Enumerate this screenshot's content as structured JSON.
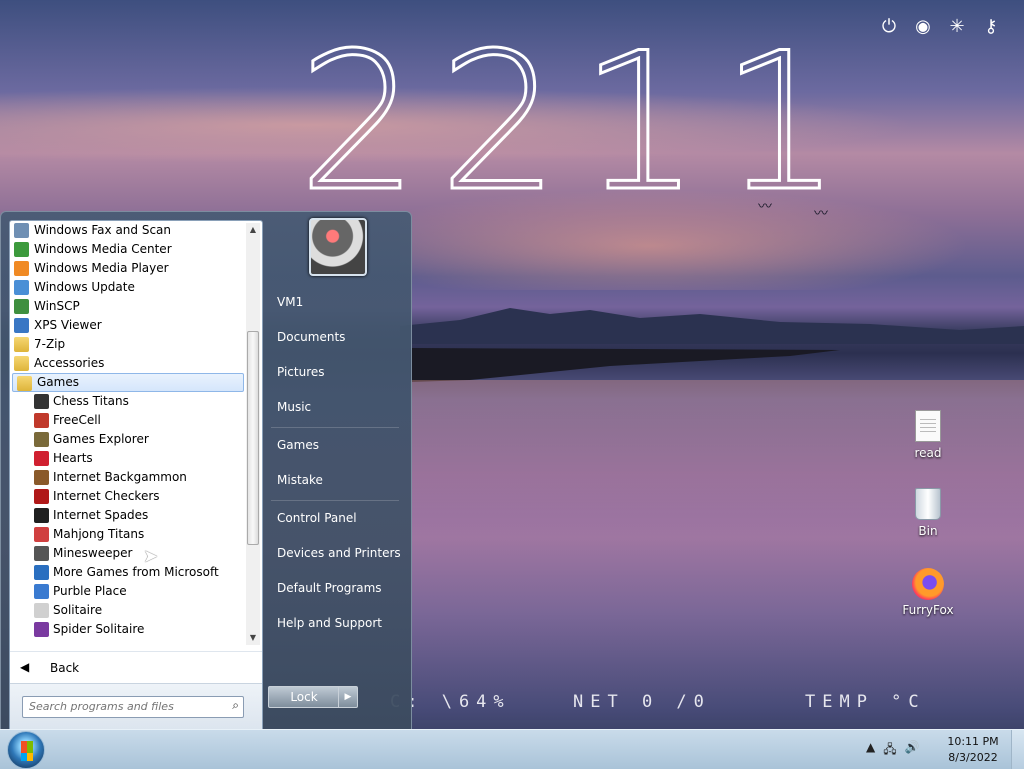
{
  "desktop": {
    "clock_display": "2211",
    "stats": {
      "cpu": "C: \\64%",
      "net": "NET 0 /0",
      "temp": "TEMP °C"
    },
    "top_icons": [
      "power-icon",
      "shutdown-icon",
      "loading-icon",
      "key-icon"
    ],
    "icons": [
      {
        "label": "read",
        "icon": "document-icon"
      },
      {
        "label": "Bin",
        "icon": "recycle-bin-icon"
      },
      {
        "label": "FurryFox",
        "icon": "firefox-icon"
      }
    ]
  },
  "start_menu": {
    "programs": [
      {
        "label": "Windows Fax and Scan",
        "icon": "fax-icon",
        "color": "#6f8fb3"
      },
      {
        "label": "Windows Media Center",
        "icon": "media-center-icon",
        "color": "#3c9a3c"
      },
      {
        "label": "Windows Media Player",
        "icon": "media-player-icon",
        "color": "#f08a24"
      },
      {
        "label": "Windows Update",
        "icon": "windows-update-icon",
        "color": "#4a8fd6"
      },
      {
        "label": "WinSCP",
        "icon": "winscp-icon",
        "color": "#3f8f3f"
      },
      {
        "label": "XPS Viewer",
        "icon": "xps-viewer-icon",
        "color": "#3a77c4"
      },
      {
        "label": "7-Zip",
        "icon": "folder-icon",
        "color": "#deb43a"
      },
      {
        "label": "Accessories",
        "icon": "folder-icon",
        "color": "#deb43a"
      },
      {
        "label": "Games",
        "icon": "folder-icon",
        "color": "#deb43a"
      },
      {
        "label": "Chess Titans",
        "icon": "chess-icon",
        "color": "#333333"
      },
      {
        "label": "FreeCell",
        "icon": "freecell-icon",
        "color": "#c0392b"
      },
      {
        "label": "Games Explorer",
        "icon": "games-explorer-icon",
        "color": "#7a6a3a"
      },
      {
        "label": "Hearts",
        "icon": "hearts-icon",
        "color": "#d02030"
      },
      {
        "label": "Internet Backgammon",
        "icon": "backgammon-icon",
        "color": "#8a5a2a"
      },
      {
        "label": "Internet Checkers",
        "icon": "checkers-icon",
        "color": "#b01818"
      },
      {
        "label": "Internet Spades",
        "icon": "spades-icon",
        "color": "#202020"
      },
      {
        "label": "Mahjong Titans",
        "icon": "mahjong-icon",
        "color": "#d04040"
      },
      {
        "label": "Minesweeper",
        "icon": "minesweeper-icon",
        "color": "#555555"
      },
      {
        "label": "More Games from Microsoft",
        "icon": "more-games-icon",
        "color": "#2a6fc0"
      },
      {
        "label": "Purble Place",
        "icon": "purble-place-icon",
        "color": "#3a7ad0"
      },
      {
        "label": "Solitaire",
        "icon": "solitaire-icon",
        "color": "#d0d0d0"
      },
      {
        "label": "Spider Solitaire",
        "icon": "spider-solitaire-icon",
        "color": "#7a3aa0"
      }
    ],
    "selected_program": "Games",
    "back_label": "Back",
    "search_placeholder": "Search programs and files",
    "right_links": [
      "VM1",
      "Documents",
      "Pictures",
      "Music",
      "Games",
      "Mistake",
      "Control Panel",
      "Devices and Printers",
      "Default Programs",
      "Help and Support"
    ],
    "lock_label": "Lock"
  },
  "taskbar": {
    "time": "10:11 PM",
    "date": "8/3/2022",
    "tray_icons": [
      "show-hidden-icons-icon",
      "network-icon",
      "volume-icon"
    ]
  },
  "colors": {
    "taskbar_bg": "#b8cfe2",
    "start_menu_bg": "#4b5f77",
    "selection": "#d5e6fb"
  }
}
